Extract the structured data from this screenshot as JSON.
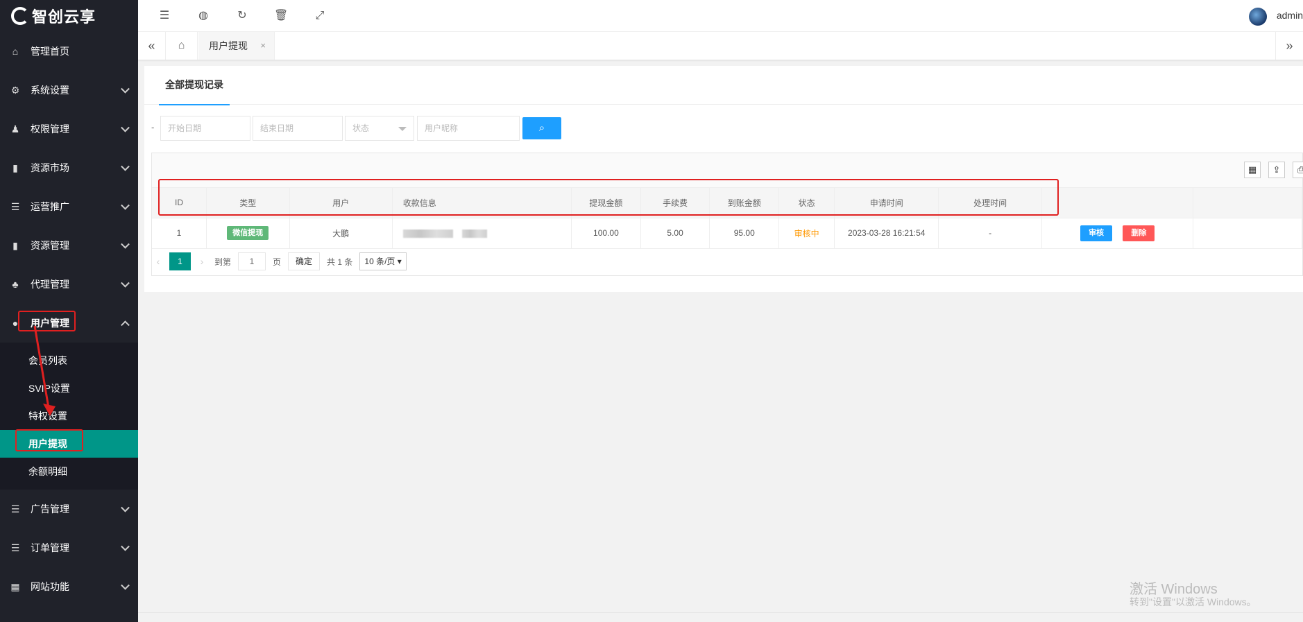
{
  "brand": {
    "logo_text": "智创云享"
  },
  "sidebar": {
    "items": [
      {
        "label": "管理首页",
        "icon": "home-icon"
      },
      {
        "label": "系统设置",
        "icon": "gear-icon"
      },
      {
        "label": "权限管理",
        "icon": "key-icon"
      },
      {
        "label": "资源市场",
        "icon": "book-icon"
      },
      {
        "label": "运营推广",
        "icon": "list-icon"
      },
      {
        "label": "资源管理",
        "icon": "book-icon"
      },
      {
        "label": "代理管理",
        "icon": "team-icon"
      },
      {
        "label": "用户管理",
        "icon": "user-icon"
      },
      {
        "label": "广告管理",
        "icon": "list-icon"
      },
      {
        "label": "订单管理",
        "icon": "list-icon"
      },
      {
        "label": "网站功能",
        "icon": "apps-icon"
      }
    ],
    "submenu": [
      "会员列表",
      "SVIP设置",
      "特权设置",
      "用户提现",
      "余额明细"
    ]
  },
  "topbar": {
    "username": "admin"
  },
  "tabs": {
    "active": "用户提现",
    "close": "×"
  },
  "card": {
    "tab_label": "全部提现记录"
  },
  "filters": {
    "dash": "-",
    "start_date": "开始日期",
    "end_date": "结束日期",
    "status": "状态",
    "nickname": "用户昵称"
  },
  "table": {
    "headers": [
      "ID",
      "类型",
      "用户",
      "收款信息",
      "提现金额",
      "手续费",
      "到账金额",
      "状态",
      "申请时间",
      "处理时间"
    ],
    "rows": [
      {
        "id": "1",
        "type": "微信提现",
        "user": "大鹏",
        "amount": "100.00",
        "fee": "5.00",
        "received": "95.00",
        "status": "审核中",
        "apply_time": "2023-03-28 16:21:54",
        "process_time": "-",
        "action_review": "审核",
        "action_delete": "删除"
      }
    ]
  },
  "pager": {
    "current": "1",
    "goto_prefix": "到第",
    "goto_value": "1",
    "page_suffix": "页",
    "confirm": "确定",
    "total": "共 1 条",
    "per_page": "10 条/页"
  },
  "watermark": {
    "line1": "激活 Windows",
    "line2": "转到\"设置\"以激活 Windows。"
  },
  "colors": {
    "sidebar_bg": "#20222a",
    "active_teal": "#009688",
    "accent_blue": "#1e9fff",
    "danger_red": "#ff5757",
    "highlight_red": "#e02020"
  }
}
